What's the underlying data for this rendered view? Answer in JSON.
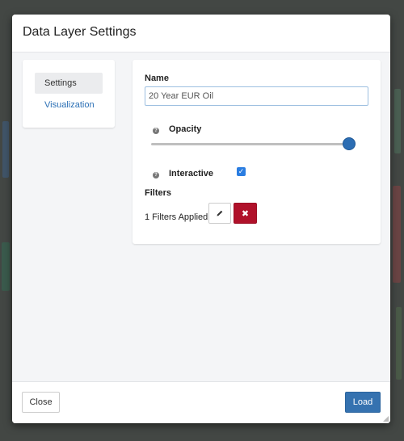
{
  "dialog": {
    "title": "Data Layer Settings"
  },
  "nav": {
    "items": [
      {
        "label": "Settings",
        "active": true
      },
      {
        "label": "Visualization",
        "active": false
      }
    ]
  },
  "form": {
    "name_label": "Name",
    "name_value": "20 Year EUR Oil",
    "opacity_label": "Opacity",
    "opacity_value": 1.0,
    "interactive_label": "Interactive",
    "interactive_checked": true,
    "filters_label": "Filters",
    "filters_status": "1 Filters Applied"
  },
  "footer": {
    "close_label": "Close",
    "load_label": "Load"
  },
  "colors": {
    "primary": "#3572b0",
    "danger": "#b0112a",
    "link": "#2a6fb5",
    "checkbox": "#2a7de1"
  }
}
